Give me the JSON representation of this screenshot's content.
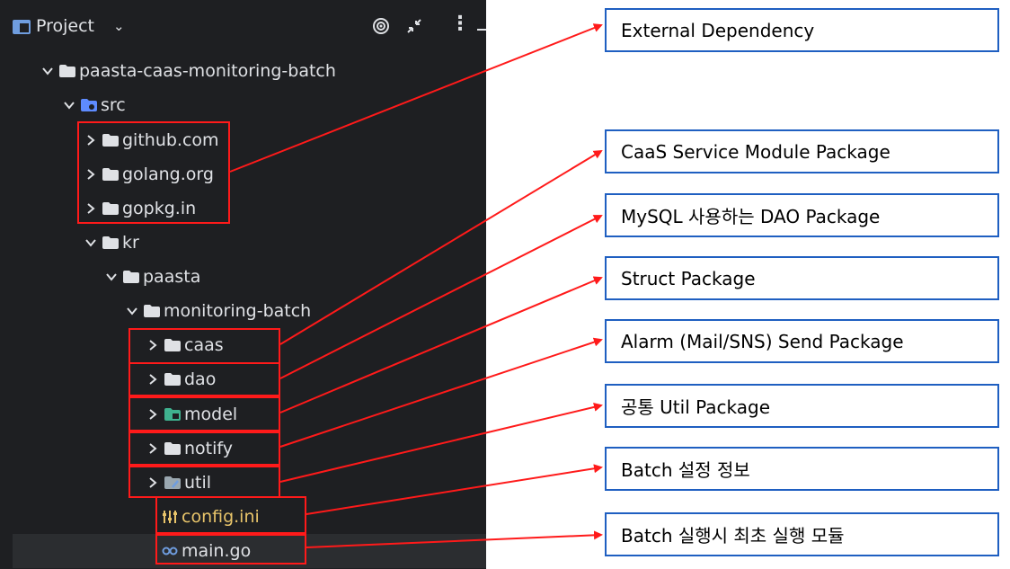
{
  "ide": {
    "title": "Project",
    "chevron": "⌄",
    "more": "⋮",
    "icons": [
      "panel-icon",
      "target-icon",
      "collapse-icon",
      "more-icon",
      "minimize-icon"
    ]
  },
  "tree": {
    "root": "paasta-caas-monitoring-batch",
    "src": "src",
    "github": "github.com",
    "golang": "golang.org",
    "gopkg": "gopkg.in",
    "kr": "kr",
    "paasta": "paasta",
    "monitoring": "monitoring-batch",
    "caas": "caas",
    "dao": "dao",
    "model": "model",
    "notify": "notify",
    "util": "util",
    "config": "config.ini",
    "main": "main.go"
  },
  "annotations": {
    "external": "External Dependency",
    "caas": "CaaS Service Module Package",
    "dao": "MySQL 사용하는 DAO Package",
    "struct": "Struct Package",
    "alarm": "Alarm (Mail/SNS) Send Package",
    "util": "공통 Util Package",
    "config": "Batch 설정 정보",
    "main": "Batch 실행시 최초 실행 모듈"
  },
  "colors": {
    "ide_bg": "#1e1f22",
    "text": "#dfe1e5",
    "folder": "#dfe1e5",
    "highlight": "#ff1a1a",
    "box_border": "#1f5fc1",
    "config_text": "#e8c46a",
    "model_icon": "#3fb28f",
    "src_icon": "#5e8bff"
  }
}
